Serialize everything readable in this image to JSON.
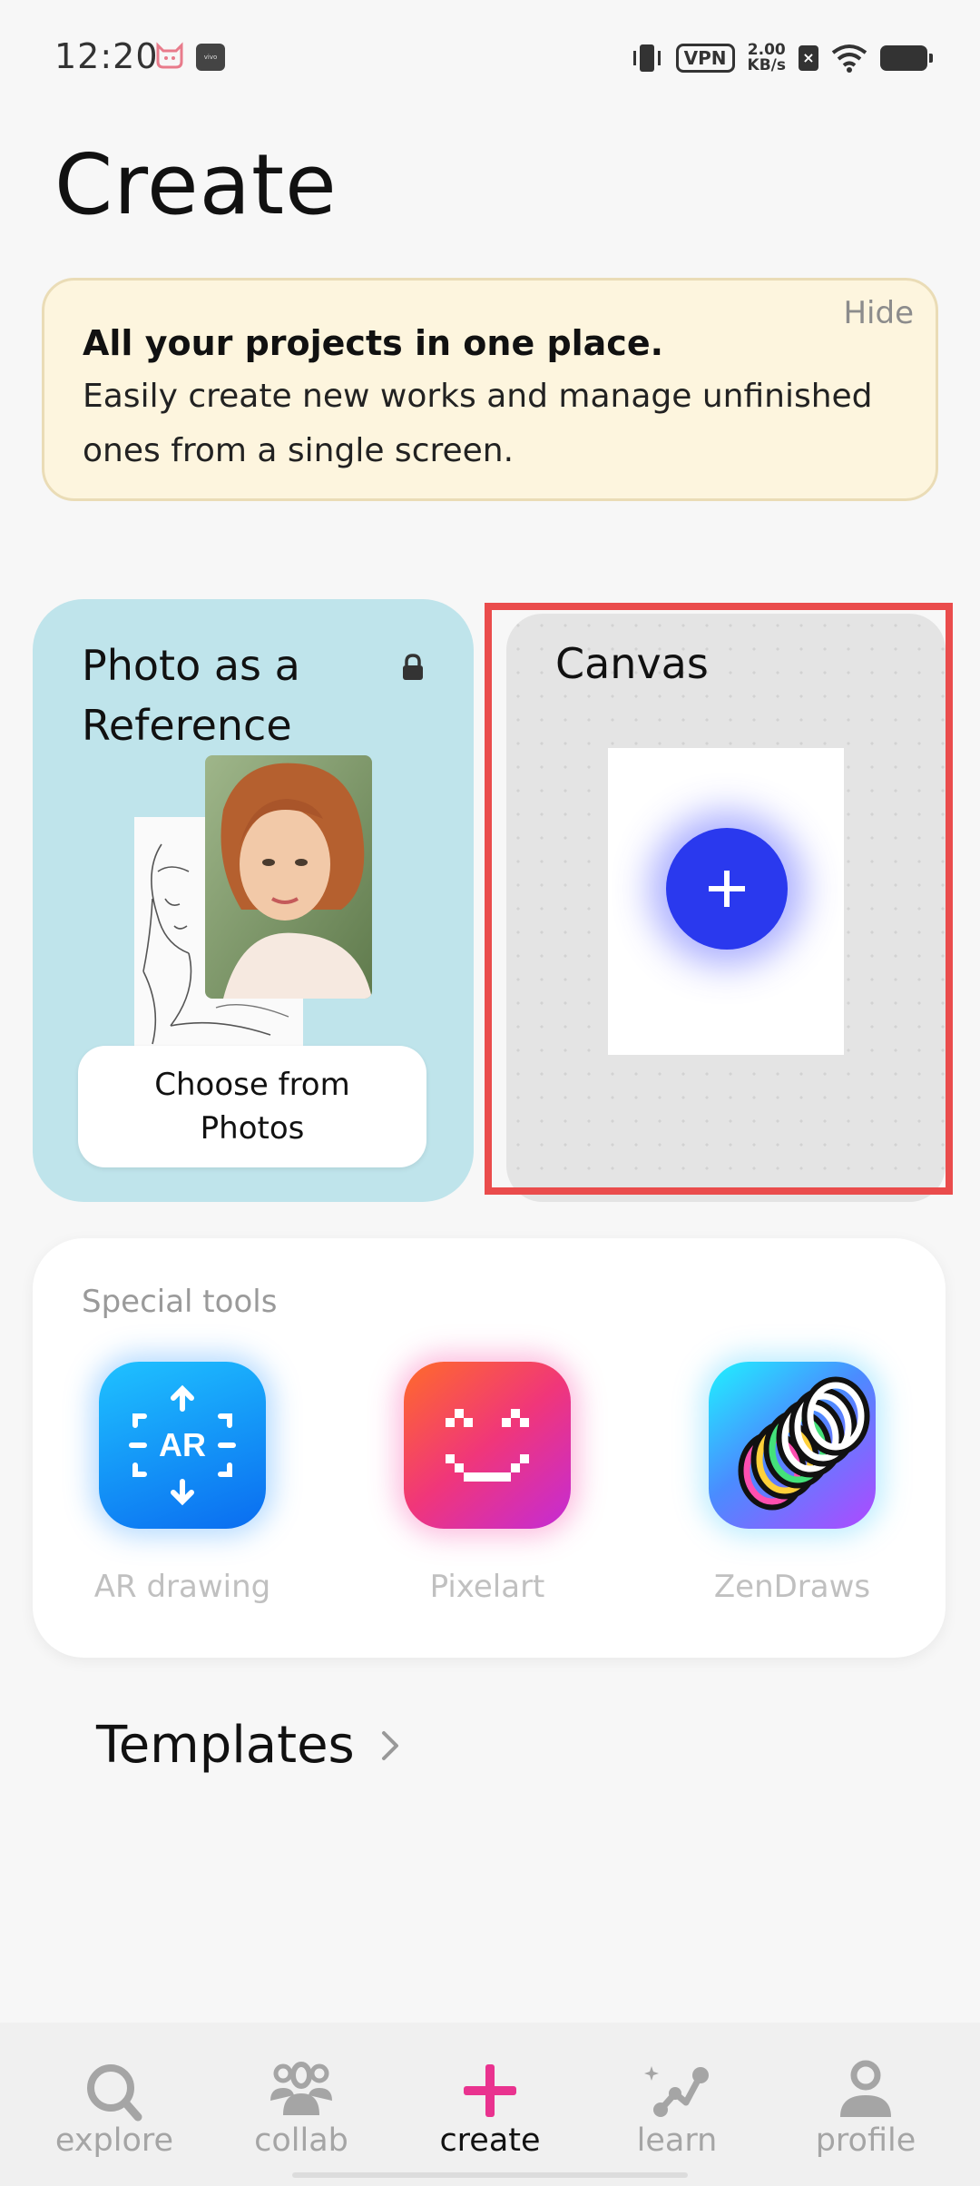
{
  "status_bar": {
    "time": "12:20",
    "vpn": "VPN",
    "speed_value": "2.00",
    "speed_unit": "KB/s",
    "vivo": "vivo"
  },
  "page_title": "Create",
  "banner": {
    "hide_label": "Hide",
    "title": "All your projects in one place.",
    "body": "Easily create new works and manage unfinished ones from a single screen."
  },
  "cards": {
    "reference": {
      "title": "Photo as a Reference",
      "button_label": "Choose from Photos"
    },
    "canvas": {
      "title": "Canvas"
    }
  },
  "special_tools": {
    "title": "Special tools",
    "items": [
      {
        "label": "AR drawing",
        "icon": "ar-icon"
      },
      {
        "label": "Pixelart",
        "icon": "pixel-smile-icon"
      },
      {
        "label": "ZenDraws",
        "icon": "zen-rings-icon"
      }
    ]
  },
  "templates": {
    "label": "Templates"
  },
  "bottom_nav": {
    "items": [
      {
        "label": "explore",
        "icon": "search-icon",
        "active": false
      },
      {
        "label": "collab",
        "icon": "people-icon",
        "active": false
      },
      {
        "label": "create",
        "icon": "plus-icon",
        "active": true
      },
      {
        "label": "learn",
        "icon": "learn-graph-icon",
        "active": false
      },
      {
        "label": "profile",
        "icon": "profile-icon",
        "active": false
      }
    ]
  },
  "colors": {
    "accent_blue": "#2a39ee",
    "highlight_red": "#ea4c4c",
    "banner_bg": "#fdf5de",
    "reference_card_bg": "#bfe4eb",
    "create_plus": "#e9338f"
  }
}
